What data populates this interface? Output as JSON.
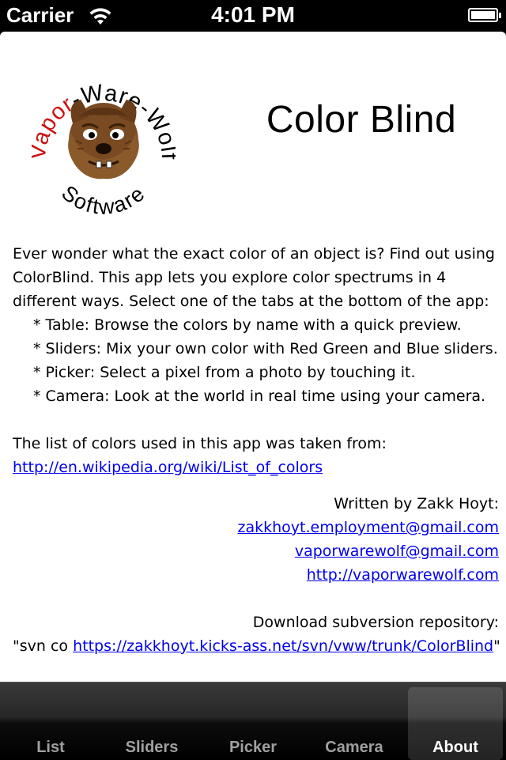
{
  "status_bar": {
    "carrier": "Carrier",
    "time": "4:01 PM",
    "wifi_icon": "wifi-icon",
    "battery_icon": "battery-icon"
  },
  "logo": {
    "arc_text_top": "Vapor-Ware-Wolf",
    "arc_text_bottom": "Software",
    "accent_color": "#cc1111",
    "icon": "wolf-face-logo"
  },
  "title": "Color Blind",
  "description": {
    "intro": "Ever wonder what the exact color of an object is? Find out using ColorBlind. This app lets you explore color spectrums in 4 different ways. Select one of the tabs at the bottom of the app:",
    "bullets": [
      "* Table: Browse the colors by name with a quick preview.",
      "* Sliders: Mix your own color with Red Green and Blue sliders.",
      "* Picker: Select a pixel from a photo by touching it.",
      "* Camera: Look at the world in real time using your camera."
    ],
    "source_text": "The list of colors used in this app was taken from:",
    "source_link": "http://en.wikipedia.org/wiki/List_of_colors"
  },
  "credits": {
    "written_by": "Written by Zakk Hoyt:",
    "email1": "zakkhoyt.employment@gmail.com",
    "email2": "vaporwarewolf@gmail.com",
    "website": "http://vaporwarewolf.com"
  },
  "repository": {
    "label": "Download subversion repository:",
    "prefix": "\"svn co ",
    "link": "https://zakkhoyt.kicks-ass.net/svn/vww/trunk/ColorBlind",
    "suffix": "\""
  },
  "tab_bar": {
    "tabs": [
      {
        "label": "List"
      },
      {
        "label": "Sliders"
      },
      {
        "label": "Picker"
      },
      {
        "label": "Camera"
      },
      {
        "label": "About",
        "active": true
      }
    ]
  },
  "colors": {
    "link": "#0000ee",
    "tab_active": "#ffffff",
    "tab_inactive": "#a0a0a0"
  }
}
